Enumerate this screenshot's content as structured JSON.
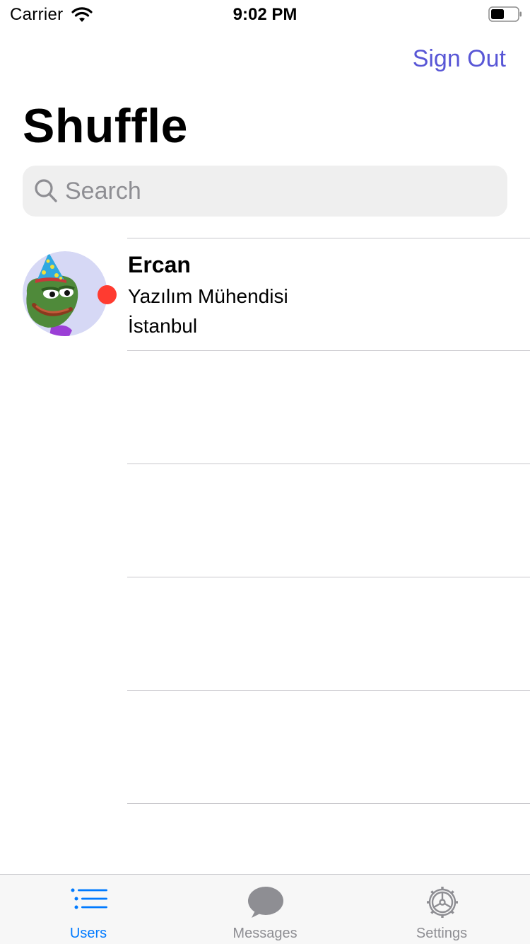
{
  "status_bar": {
    "carrier": "Carrier",
    "time": "9:02 PM",
    "battery_level": 0.5
  },
  "nav": {
    "sign_out_label": "Sign Out",
    "title": "Shuffle"
  },
  "search": {
    "placeholder": "Search",
    "value": ""
  },
  "users": [
    {
      "name": "Ercan",
      "job": "Yazılım Mühendisi",
      "city": "İstanbul",
      "online_status_color": "#ff3b30"
    }
  ],
  "tab_bar": {
    "tabs": [
      {
        "label": "Users",
        "icon": "list-icon",
        "selected": true
      },
      {
        "label": "Messages",
        "icon": "chat-bubble-icon",
        "selected": false
      },
      {
        "label": "Settings",
        "icon": "gear-icon",
        "selected": false
      }
    ]
  },
  "colors": {
    "accent": "#5856d6",
    "tab_active": "#007aff",
    "tab_inactive": "#8e8e93",
    "separator": "#c8c7cc",
    "search_background": "#efefef"
  }
}
